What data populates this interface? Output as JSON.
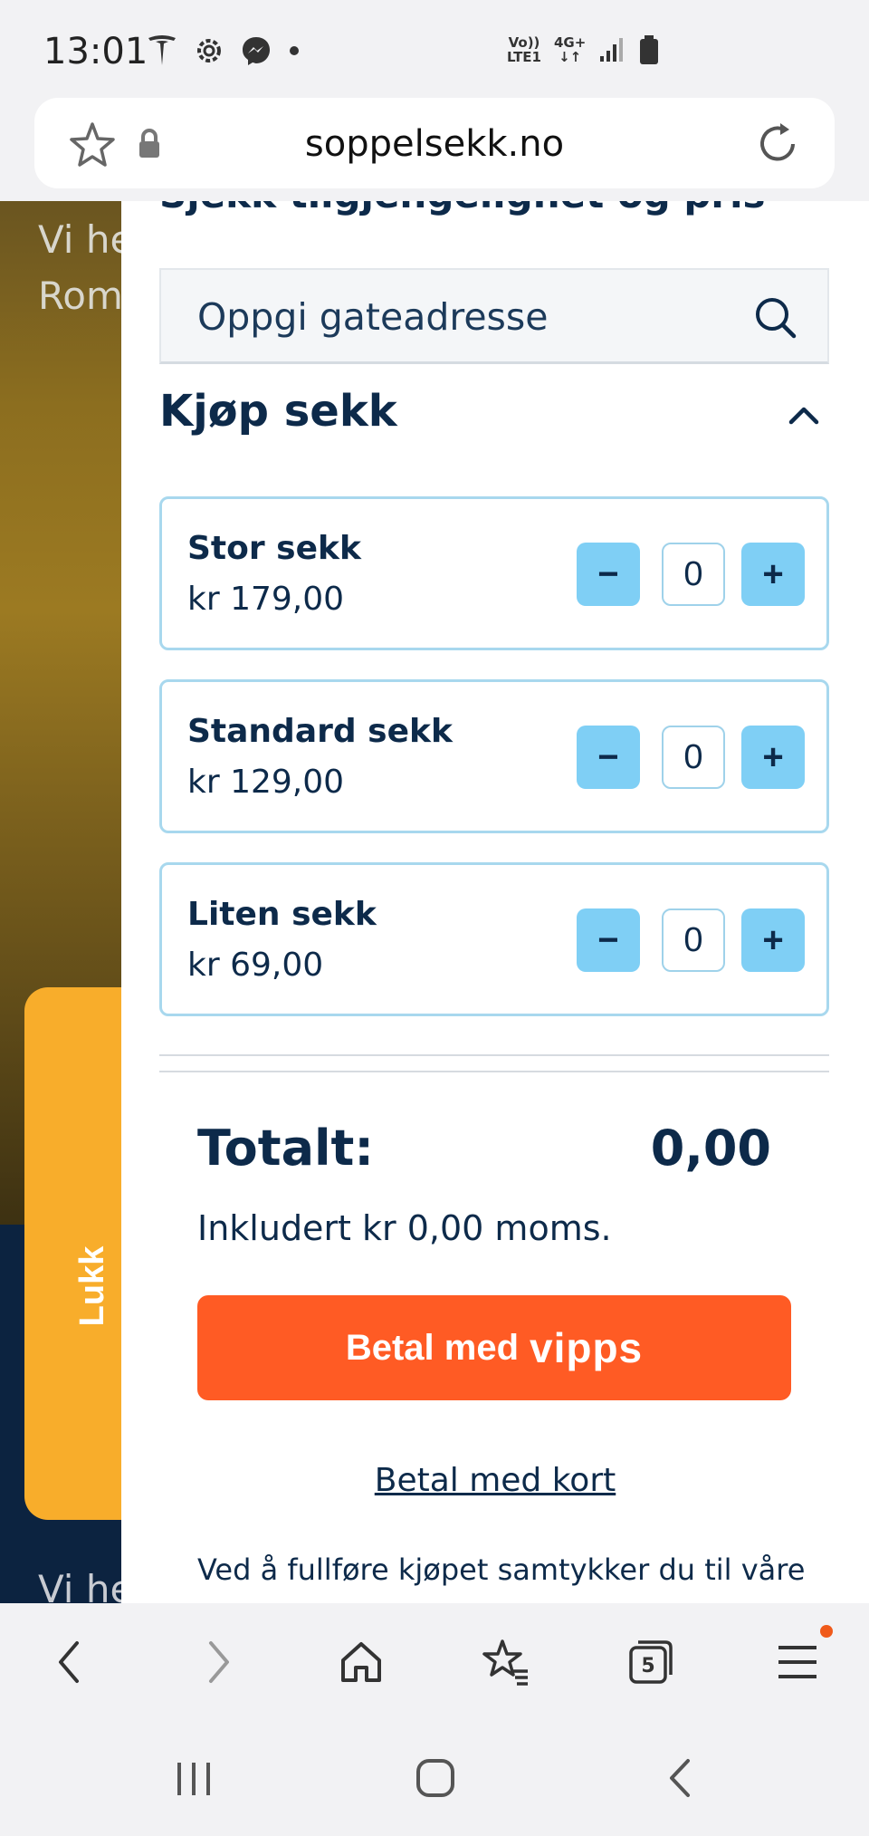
{
  "status_bar": {
    "time": "13:01",
    "net_top": "Vo))",
    "net_bottom": "LTE1",
    "net_type": "4G+"
  },
  "browser": {
    "url": "soppelsekk.no",
    "tab_count": "5"
  },
  "background": {
    "text_line1": "Vi he",
    "text_line2": "Rom",
    "text_line3": "Vi he"
  },
  "close_tab": {
    "label": "Lukk"
  },
  "drawer": {
    "heading_partial": "Sjekk tilgjengelighet og pris",
    "search": {
      "placeholder": "Oppgi gateadresse"
    },
    "section_title": "Kjøp sekk",
    "products": [
      {
        "name": "Stor sekk",
        "price": "kr 179,00",
        "quantity": "0"
      },
      {
        "name": "Standard sekk",
        "price": "kr 129,00",
        "quantity": "0"
      },
      {
        "name": "Liten sekk",
        "price": "kr 69,00",
        "quantity": "0"
      }
    ],
    "total_label": "Totalt:",
    "total_value": "0,00",
    "vat_text": "Inkludert kr 0,00 moms.",
    "vipps_button_prefix": "Betal med",
    "vipps_logo_text": "vipps",
    "card_link": "Betal med kort",
    "terms_text": "Ved å fullføre kjøpet samtykker du til våre"
  },
  "colors": {
    "brand_navy": "#0d2a4a",
    "qty_button": "#7fcff5",
    "card_border": "#a8d8ee",
    "vipps_orange": "#ff5b24",
    "close_tab": "#f8ad2b"
  }
}
